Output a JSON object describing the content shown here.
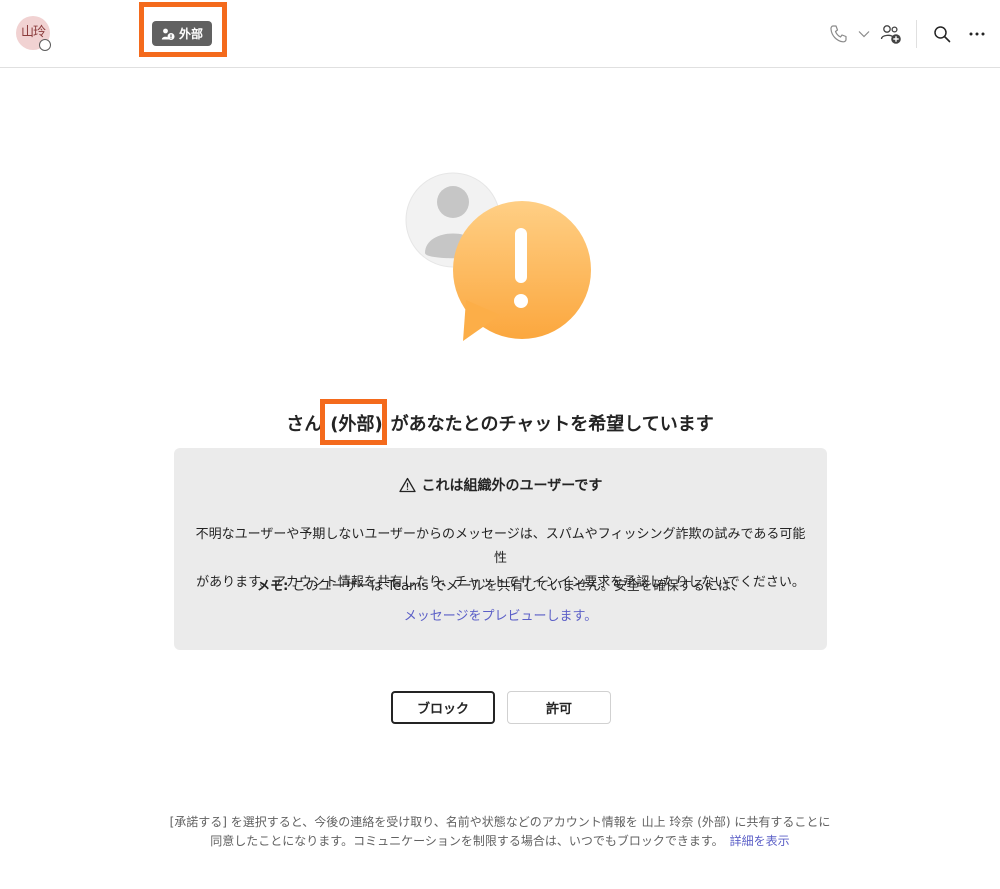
{
  "header": {
    "avatar_initials": "山玲",
    "external_badge_label": "外部",
    "icons": [
      "call-icon",
      "chevron-down-icon",
      "add-people-icon",
      "search-icon",
      "more-options-icon"
    ]
  },
  "request": {
    "title_prefix": "さん",
    "title_external": "(外部)",
    "title_suffix": "があなたとのチャットを希望しています"
  },
  "notice": {
    "heading": "これは組織外のユーザーです",
    "body_line1": "不明なユーザーや予期しないユーザーからのメッセージは、スパムやフィッシング詐欺の試みである可能性",
    "body_line2": "があります。アカウント情報を共有したり、チャットでサインイン要求を承認したりしないでください。",
    "memo_label": "メモ:",
    "memo_text": " このユーザーは Teams でメールを共有していません。安全を確保するには、",
    "preview_link": "メッセージをプレビューします。"
  },
  "actions": {
    "block_label": "ブロック",
    "allow_label": "許可"
  },
  "footer": {
    "line1": "[承諾する] を選択すると、今後の連絡を受け取り、名前や状態などのアカウント情報を 山上 玲奈 (外部) に共有することに",
    "line2": "同意したことになります。コミュニケーションを制限する場合は、いつでもブロックできます。",
    "details_link": "詳細を表示"
  },
  "colors": {
    "highlight": "#f46a1c",
    "badge": "#616161",
    "link": "#5b5fc7",
    "warning_bubble": "#ffb84d",
    "card": "#ebebeb"
  }
}
